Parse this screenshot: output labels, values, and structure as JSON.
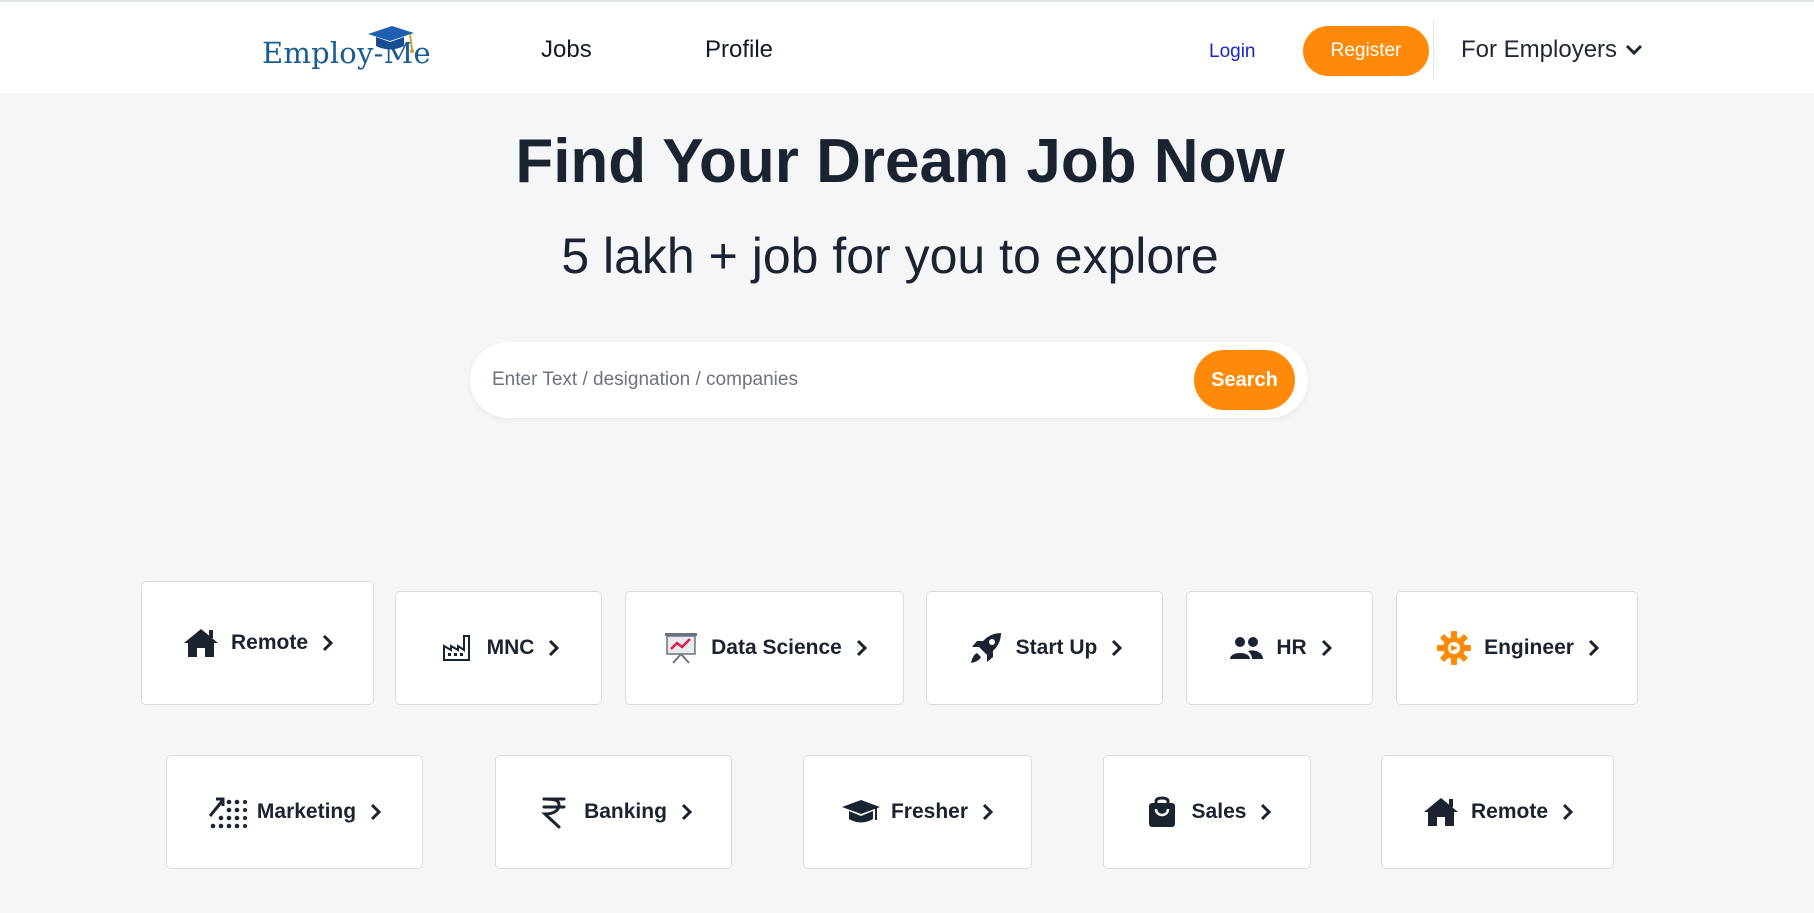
{
  "header": {
    "logo_text": "Employ-Me",
    "nav": {
      "jobs": "Jobs",
      "profile": "Profile"
    },
    "login": "Login",
    "register": "Register",
    "for_employers": "For Employers"
  },
  "hero": {
    "title": "Find Your Dream Job Now",
    "subtitle": "5 lakh + job for you to explore"
  },
  "search": {
    "placeholder": "Enter Text / designation / companies",
    "button": "Search"
  },
  "categories_row1": [
    {
      "label": "Remote",
      "icon": "home-icon"
    },
    {
      "label": "MNC",
      "icon": "factory-icon"
    },
    {
      "label": "Data Science",
      "icon": "presentation-chart-icon"
    },
    {
      "label": "Start Up",
      "icon": "rocket-icon"
    },
    {
      "label": "HR",
      "icon": "people-icon"
    },
    {
      "label": "Engineer",
      "icon": "gear-icon"
    }
  ],
  "categories_row2": [
    {
      "label": "Marketing",
      "icon": "growth-icon"
    },
    {
      "label": "Banking",
      "icon": "rupee-icon"
    },
    {
      "label": "Fresher",
      "icon": "graduation-cap-icon"
    },
    {
      "label": "Sales",
      "icon": "shopping-bag-icon"
    },
    {
      "label": "Remote",
      "icon": "home-icon"
    }
  ],
  "colors": {
    "accent": "#ff8a09",
    "login": "#1d24c9",
    "logo": "#1a5d94",
    "text": "#1b2230",
    "background": "#f5f6f8"
  }
}
